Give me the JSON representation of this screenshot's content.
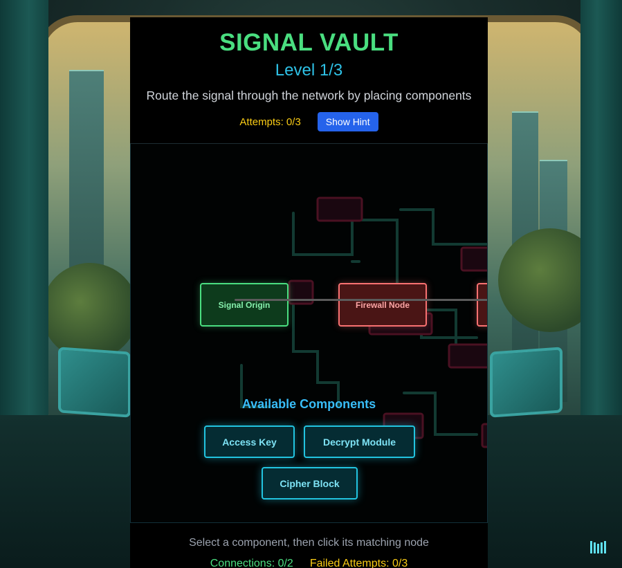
{
  "header": {
    "title": "SIGNAL VAULT",
    "level": "Level 1/3",
    "subtitle": "Route the signal through the network by placing components",
    "attempts": "Attempts: 0/3",
    "hint_button": "Show Hint"
  },
  "board": {
    "nodes": [
      {
        "label": "Signal Origin",
        "state": "connected"
      },
      {
        "label": "Firewall Node",
        "state": "locked"
      },
      {
        "label": "",
        "state": "locked"
      }
    ],
    "components_title": "Available Components",
    "components": [
      "Access Key",
      "Decrypt Module",
      "Cipher Block"
    ]
  },
  "footer": {
    "instruction": "Select a component, then click its matching node",
    "connections": "Connections: 0/2",
    "failed_attempts": "Failed Attempts: 0/3"
  },
  "colors": {
    "title": "#4ade80",
    "level": "#2ec1e6",
    "attempts": "#facc15",
    "hint_button": "#2563eb",
    "origin_node": "#4ade80",
    "firewall_node": "#f87171",
    "component_border": "#22c4e0"
  },
  "icons": {
    "corner_logo": "signal-bars-icon"
  }
}
